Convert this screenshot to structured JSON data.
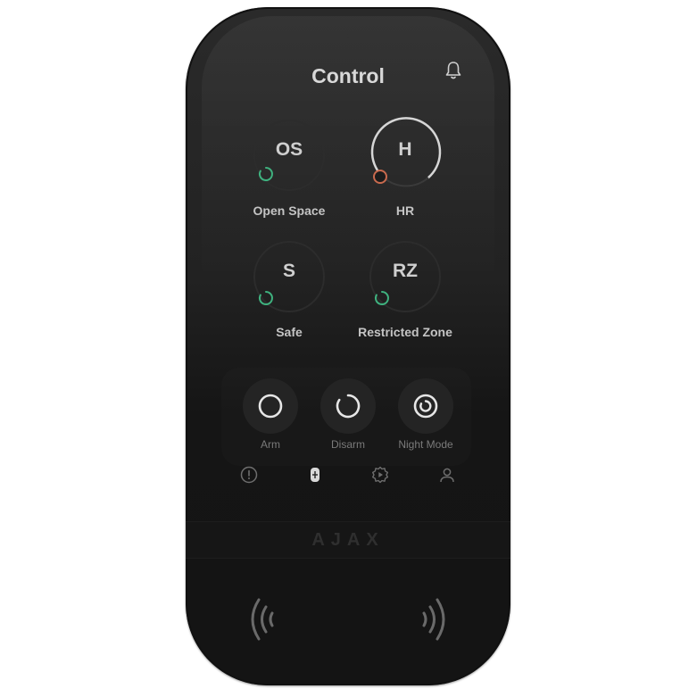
{
  "header": {
    "title": "Control"
  },
  "groups": [
    {
      "initials": "OS",
      "label": "Open Space",
      "status": "disarmed",
      "status_color": "#3fb27f"
    },
    {
      "initials": "H",
      "label": "HR",
      "status": "armed",
      "status_color": "#c96a4e"
    },
    {
      "initials": "S",
      "label": "Safe",
      "status": "disarmed",
      "status_color": "#3fb27f"
    },
    {
      "initials": "RZ",
      "label": "Restricted Zone",
      "status": "disarmed",
      "status_color": "#3fb27f"
    }
  ],
  "modes": [
    {
      "label": "Arm",
      "icon": "arm-icon"
    },
    {
      "label": "Disarm",
      "icon": "disarm-icon"
    },
    {
      "label": "Night Mode",
      "icon": "night-mode-icon"
    }
  ],
  "nav": [
    {
      "icon": "alert-icon"
    },
    {
      "icon": "device-icon"
    },
    {
      "icon": "scenarios-gear-icon"
    },
    {
      "icon": "user-icon"
    }
  ],
  "brand": {
    "logo": "AJAX"
  }
}
